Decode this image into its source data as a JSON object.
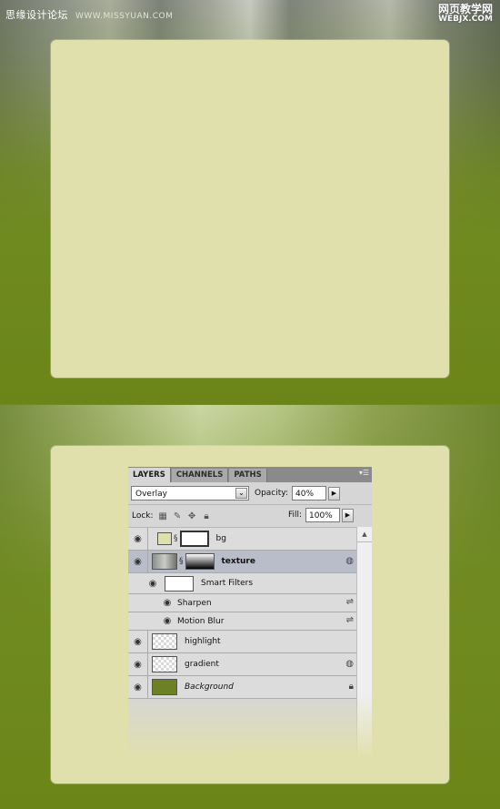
{
  "watermark": {
    "left_cn": "思缘设计论坛",
    "left_site": "WWW.MISSYUAN.COM",
    "right_cn": "网页教学网",
    "right_en": "WEBJX.COM"
  },
  "layers_panel": {
    "tabs": [
      "LAYERS",
      "CHANNELS",
      "PATHS"
    ],
    "blend_mode": "Overlay",
    "opacity_label": "Opacity:",
    "opacity_value": "40%",
    "lock_label": "Lock:",
    "fill_label": "Fill:",
    "fill_value": "100%",
    "layers": [
      {
        "name": "bg"
      },
      {
        "name": "texture"
      },
      {
        "name": "highlight"
      },
      {
        "name": "gradient"
      },
      {
        "name": "Background"
      }
    ],
    "smart_filters_label": "Smart Filters",
    "filters": [
      "Sharpen",
      "Motion Blur"
    ]
  },
  "colors": {
    "card": "#e0e0ad",
    "background_green": "#6f8a1f",
    "panel_gray": "#d6d6d6",
    "selected_row": "#b9bcc9"
  }
}
